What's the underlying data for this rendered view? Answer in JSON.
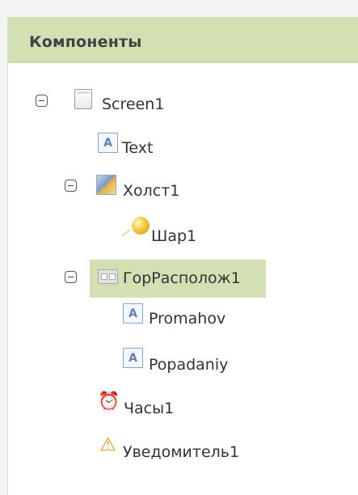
{
  "panel": {
    "title": "Компоненты"
  },
  "tree": {
    "screen": {
      "label": "Screen1"
    },
    "text": {
      "label": "Text"
    },
    "canvas": {
      "label": "Холст1"
    },
    "ball": {
      "label": "Шар1"
    },
    "hlayout": {
      "label": "ГорРасполож1"
    },
    "promahov": {
      "label": "Promahov"
    },
    "popadaniy": {
      "label": "Popadaniy"
    },
    "clock": {
      "label": "Часы1"
    },
    "notifier": {
      "label": "Уведомитель1"
    }
  },
  "icons": {
    "label_glyph": "A",
    "clock_glyph": "⏰",
    "warn_glyph": "⚠"
  },
  "colors": {
    "header_bg": "#d3e0b4",
    "selected_bg": "#d3e0b4"
  }
}
